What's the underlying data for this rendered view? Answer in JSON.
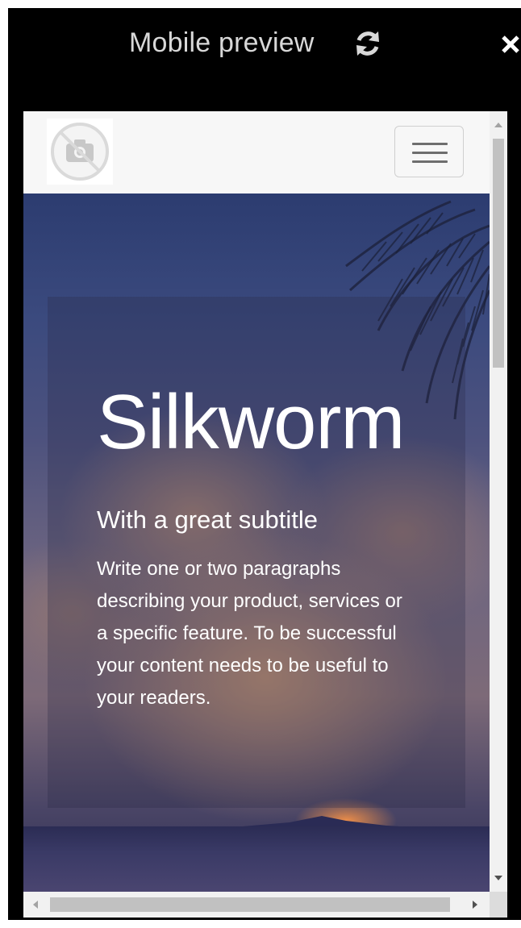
{
  "window": {
    "title": "Mobile preview",
    "refresh_icon": "refresh-icon",
    "close_icon": "close-icon"
  },
  "navbar": {
    "logo_icon": "no-image-placeholder-icon",
    "menu_icon": "hamburger-menu-icon"
  },
  "hero": {
    "title": "Silkworm",
    "subtitle": "With a great subtitle",
    "paragraph": "Write one or two paragraphs describing your product, services or a specific feature. To be successful your content needs to be useful to your readers."
  },
  "scrollbars": {
    "vertical": {
      "position": 0.0,
      "visible_fraction": 0.3
    },
    "horizontal": {
      "position": 0.0,
      "visible_fraction": 0.92
    }
  },
  "colors": {
    "frame_bg": "#000000",
    "title_text": "#d8d8d8",
    "navbar_bg": "#f7f7f7",
    "hero_text": "#ffffff"
  }
}
